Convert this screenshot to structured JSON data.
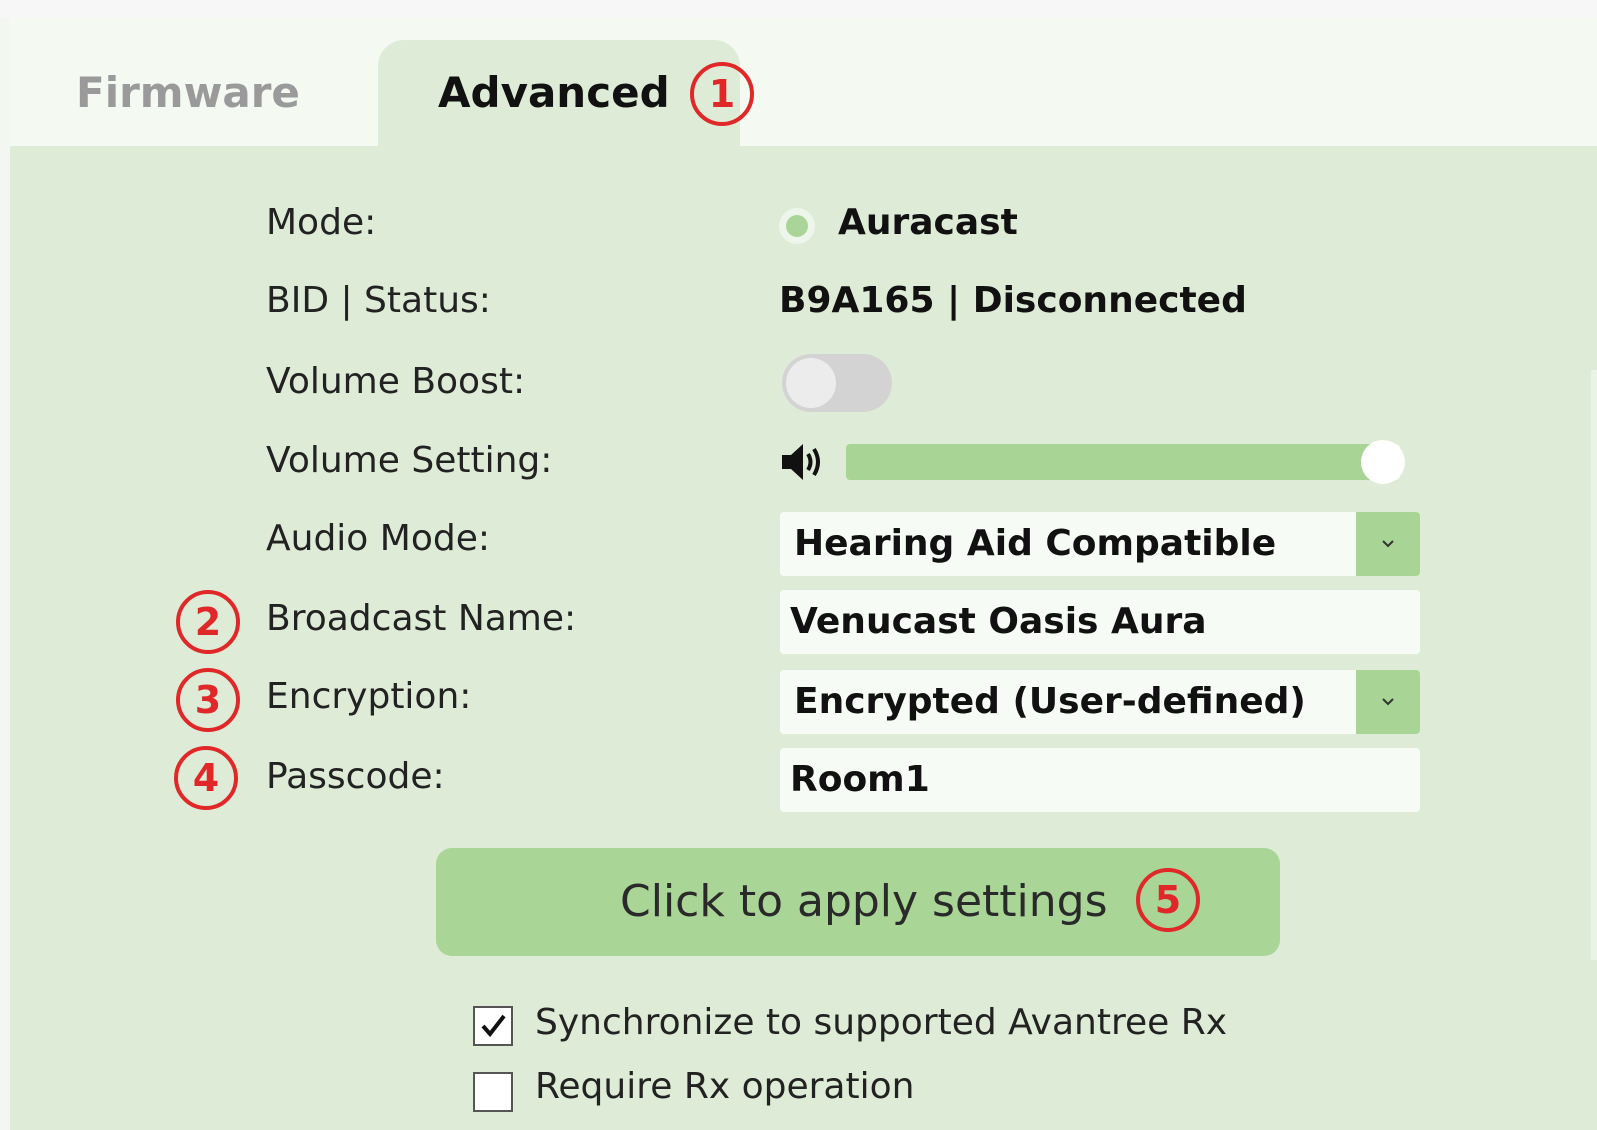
{
  "tabs": [
    {
      "label": "Firmware",
      "active": false
    },
    {
      "label": "Advanced",
      "active": true
    }
  ],
  "callouts": [
    "1",
    "2",
    "3",
    "4",
    "5"
  ],
  "fields": {
    "mode": {
      "label": "Mode:",
      "value": "Auracast"
    },
    "bid_status": {
      "label": "BID | Status:",
      "value": "B9A165 | Disconnected"
    },
    "volume_boost": {
      "label": "Volume Boost:",
      "enabled": false
    },
    "volume_setting": {
      "label": "Volume Setting:",
      "level_percent": 97
    },
    "audio_mode": {
      "label": "Audio Mode:",
      "value": "Hearing Aid Compatible"
    },
    "broadcast_name": {
      "label": "Broadcast Name:",
      "value": "Venucast Oasis Aura"
    },
    "encryption": {
      "label": "Encryption:",
      "value": "Encrypted (User-defined)"
    },
    "passcode": {
      "label": "Passcode:",
      "value": "Room1"
    }
  },
  "apply_button": {
    "label": "Click to apply settings"
  },
  "checkboxes": [
    {
      "label": "Synchronize to supported Avantree Rx",
      "checked": true
    },
    {
      "label": "Require Rx operation",
      "checked": false
    }
  ],
  "colors": {
    "accent_green": "#a8d495",
    "panel_bg": "#deecd7",
    "callout_red": "#e02828"
  },
  "icons": [
    "speaker-icon",
    "chevron-down-icon",
    "checkmark-icon"
  ]
}
